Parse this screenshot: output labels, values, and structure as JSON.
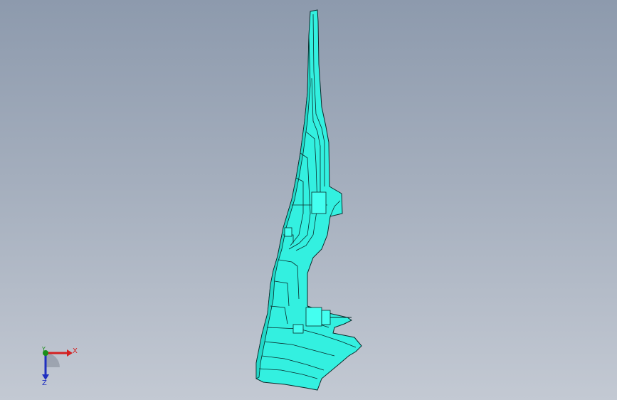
{
  "viewport": {
    "background_top": "#8d9aad",
    "background_bottom": "#c3c9d3"
  },
  "model": {
    "fill_color": "#33f0e0",
    "edge_color": "#0a2a2a"
  },
  "triad": {
    "x_label": "X",
    "y_label": "Y",
    "z_label": "Z",
    "x_color": "#d42020",
    "y_color": "#1a8f1a",
    "z_color": "#2030c0"
  }
}
